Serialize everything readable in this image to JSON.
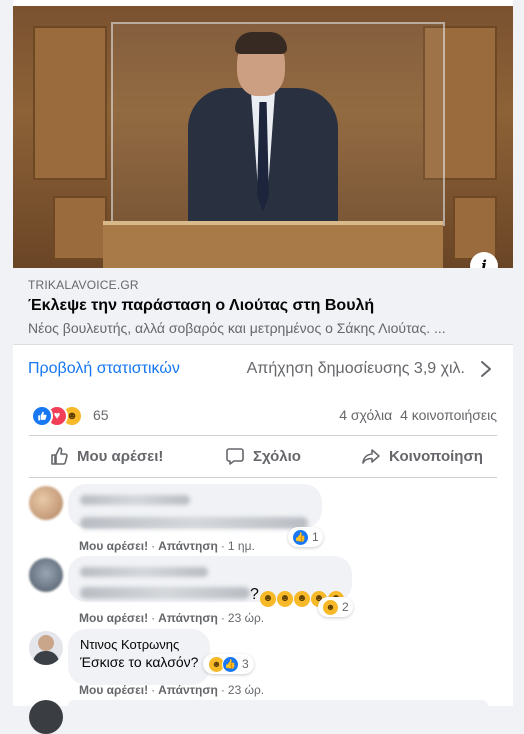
{
  "link_preview": {
    "domain": "TRIKALAVOICE.GR",
    "title": "Έκλεψε την παράσταση ο Λιούτας στη Βουλή",
    "description": "Νέος βουλευτής, αλλά σοβαρός και μετρημένος ο Σάκης Λιούτας. ...",
    "info_icon": "i"
  },
  "stats": {
    "view_insights": "Προβολή στατιστικών",
    "post_reach": "Απήχηση δημοσίευσης 3,9 χιλ."
  },
  "reactions": {
    "icons": [
      "like-icon",
      "love-icon",
      "haha-icon"
    ],
    "count": "65",
    "comments": "4 σχόλια",
    "shares": "4 κοινοποιήσεις"
  },
  "actions": {
    "like": "Μου αρέσει!",
    "comment": "Σχόλιο",
    "share": "Κοινοποίηση"
  },
  "comments": [
    {
      "name": "",
      "text": "",
      "like_label": "Μου αρέσει!",
      "reply_label": "Απάντηση",
      "time": "1 ημ.",
      "reaction_count": "1"
    },
    {
      "name": "",
      "text": "?",
      "like_label": "Μου αρέσει!",
      "reply_label": "Απάντηση",
      "time": "23 ώρ.",
      "reaction_count": "2"
    },
    {
      "name": "Ντινος Κοτρωνης",
      "text": "Έσκισε το καλσόν?",
      "like_label": "Μου αρέσει!",
      "reply_label": "Απάντηση",
      "time": "23 ώρ.",
      "reaction_count": "3"
    }
  ],
  "colors": {
    "accent": "#1877f2",
    "secondary_text": "#65676b",
    "background": "#f0f2f5"
  }
}
